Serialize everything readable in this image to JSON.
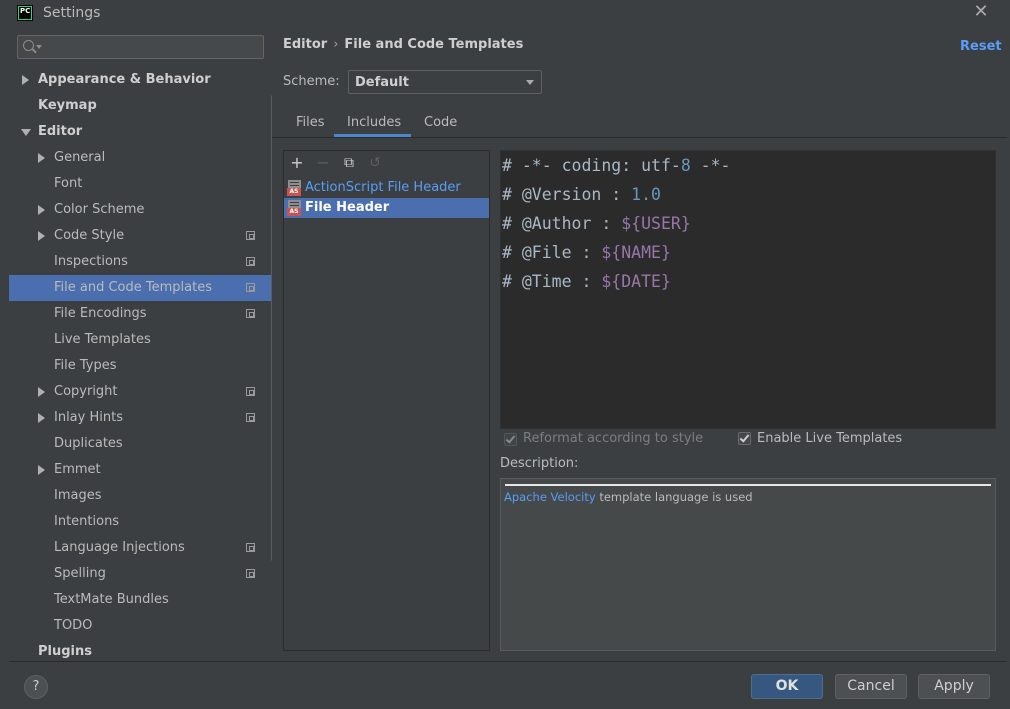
{
  "window": {
    "title": "Settings",
    "app_icon": "PC"
  },
  "sidebar": {
    "search": {
      "placeholder": ""
    },
    "items": [
      {
        "label": "Appearance & Behavior",
        "bold": true,
        "level": 0,
        "arrow": "right",
        "project_icon": false
      },
      {
        "label": "Keymap",
        "bold": true,
        "level": 0,
        "arrow": "",
        "project_icon": false
      },
      {
        "label": "Editor",
        "bold": true,
        "level": 0,
        "arrow": "down",
        "project_icon": false
      },
      {
        "label": "General",
        "level": 1,
        "arrow": "right",
        "project_icon": false
      },
      {
        "label": "Font",
        "level": 1,
        "arrow": "",
        "project_icon": false
      },
      {
        "label": "Color Scheme",
        "level": 1,
        "arrow": "right",
        "project_icon": false
      },
      {
        "label": "Code Style",
        "level": 1,
        "arrow": "right",
        "project_icon": true
      },
      {
        "label": "Inspections",
        "level": 1,
        "arrow": "",
        "project_icon": true
      },
      {
        "label": "File and Code Templates",
        "level": 1,
        "arrow": "",
        "project_icon": true,
        "selected": true
      },
      {
        "label": "File Encodings",
        "level": 1,
        "arrow": "",
        "project_icon": true
      },
      {
        "label": "Live Templates",
        "level": 1,
        "arrow": "",
        "project_icon": false
      },
      {
        "label": "File Types",
        "level": 1,
        "arrow": "",
        "project_icon": false
      },
      {
        "label": "Copyright",
        "level": 1,
        "arrow": "right",
        "project_icon": true
      },
      {
        "label": "Inlay Hints",
        "level": 1,
        "arrow": "right",
        "project_icon": true
      },
      {
        "label": "Duplicates",
        "level": 1,
        "arrow": "",
        "project_icon": false
      },
      {
        "label": "Emmet",
        "level": 1,
        "arrow": "right",
        "project_icon": false
      },
      {
        "label": "Images",
        "level": 1,
        "arrow": "",
        "project_icon": false
      },
      {
        "label": "Intentions",
        "level": 1,
        "arrow": "",
        "project_icon": false
      },
      {
        "label": "Language Injections",
        "level": 1,
        "arrow": "",
        "project_icon": true
      },
      {
        "label": "Spelling",
        "level": 1,
        "arrow": "",
        "project_icon": true
      },
      {
        "label": "TextMate Bundles",
        "level": 1,
        "arrow": "",
        "project_icon": false
      },
      {
        "label": "TODO",
        "level": 1,
        "arrow": "",
        "project_icon": false
      },
      {
        "label": "Plugins",
        "bold": true,
        "level": 0,
        "arrow": "",
        "project_icon": false
      }
    ]
  },
  "header": {
    "breadcrumb": [
      "Editor",
      "File and Code Templates"
    ],
    "breadcrumb_sep": "›",
    "reset_label": "Reset"
  },
  "scheme": {
    "label": "Scheme:",
    "value": "Default"
  },
  "tabs": [
    {
      "label": "Files",
      "active": false
    },
    {
      "label": "Includes",
      "active": true
    },
    {
      "label": "Code",
      "active": false
    }
  ],
  "toolbar": {
    "add": "+",
    "remove": "−",
    "copy": "⧉",
    "reset": "↺"
  },
  "templates": [
    {
      "name": "ActionScript File Header",
      "badge": "AS",
      "selected": false
    },
    {
      "name": "File Header",
      "badge": "AS",
      "selected": true
    }
  ],
  "editor": {
    "lines": [
      [
        {
          "t": "# -*- coding: utf-",
          "c": "plain"
        },
        {
          "t": "8",
          "c": "num"
        },
        {
          "t": " -*-",
          "c": "plain"
        }
      ],
      [
        {
          "t": "# @Version : ",
          "c": "plain"
        },
        {
          "t": "1.0",
          "c": "num"
        }
      ],
      [
        {
          "t": "# @Author : ",
          "c": "plain"
        },
        {
          "t": "${USER}",
          "c": "var"
        }
      ],
      [
        {
          "t": "# @File : ",
          "c": "plain"
        },
        {
          "t": "${NAME}",
          "c": "var"
        }
      ],
      [
        {
          "t": "# @Time : ",
          "c": "plain"
        },
        {
          "t": "${DATE}",
          "c": "var"
        }
      ]
    ]
  },
  "options": {
    "reformat": {
      "label": "Reformat according to style",
      "checked": true,
      "enabled": false
    },
    "live_templates": {
      "label": "Enable Live Templates",
      "checked": true,
      "enabled": true
    }
  },
  "description": {
    "label": "Description:",
    "link": "Apache Velocity",
    "text": " template language is used"
  },
  "footer": {
    "help": "?",
    "ok": "OK",
    "cancel": "Cancel",
    "apply": "Apply"
  },
  "colors": {
    "background": "#3c3f41",
    "selection": "#4b6eaf",
    "link": "#589df6",
    "editor_bg": "#2b2b2b",
    "code_text": "#a9b7c6",
    "code_number": "#6897bb",
    "code_variable": "#9876aa",
    "primary_button": "#365880"
  }
}
